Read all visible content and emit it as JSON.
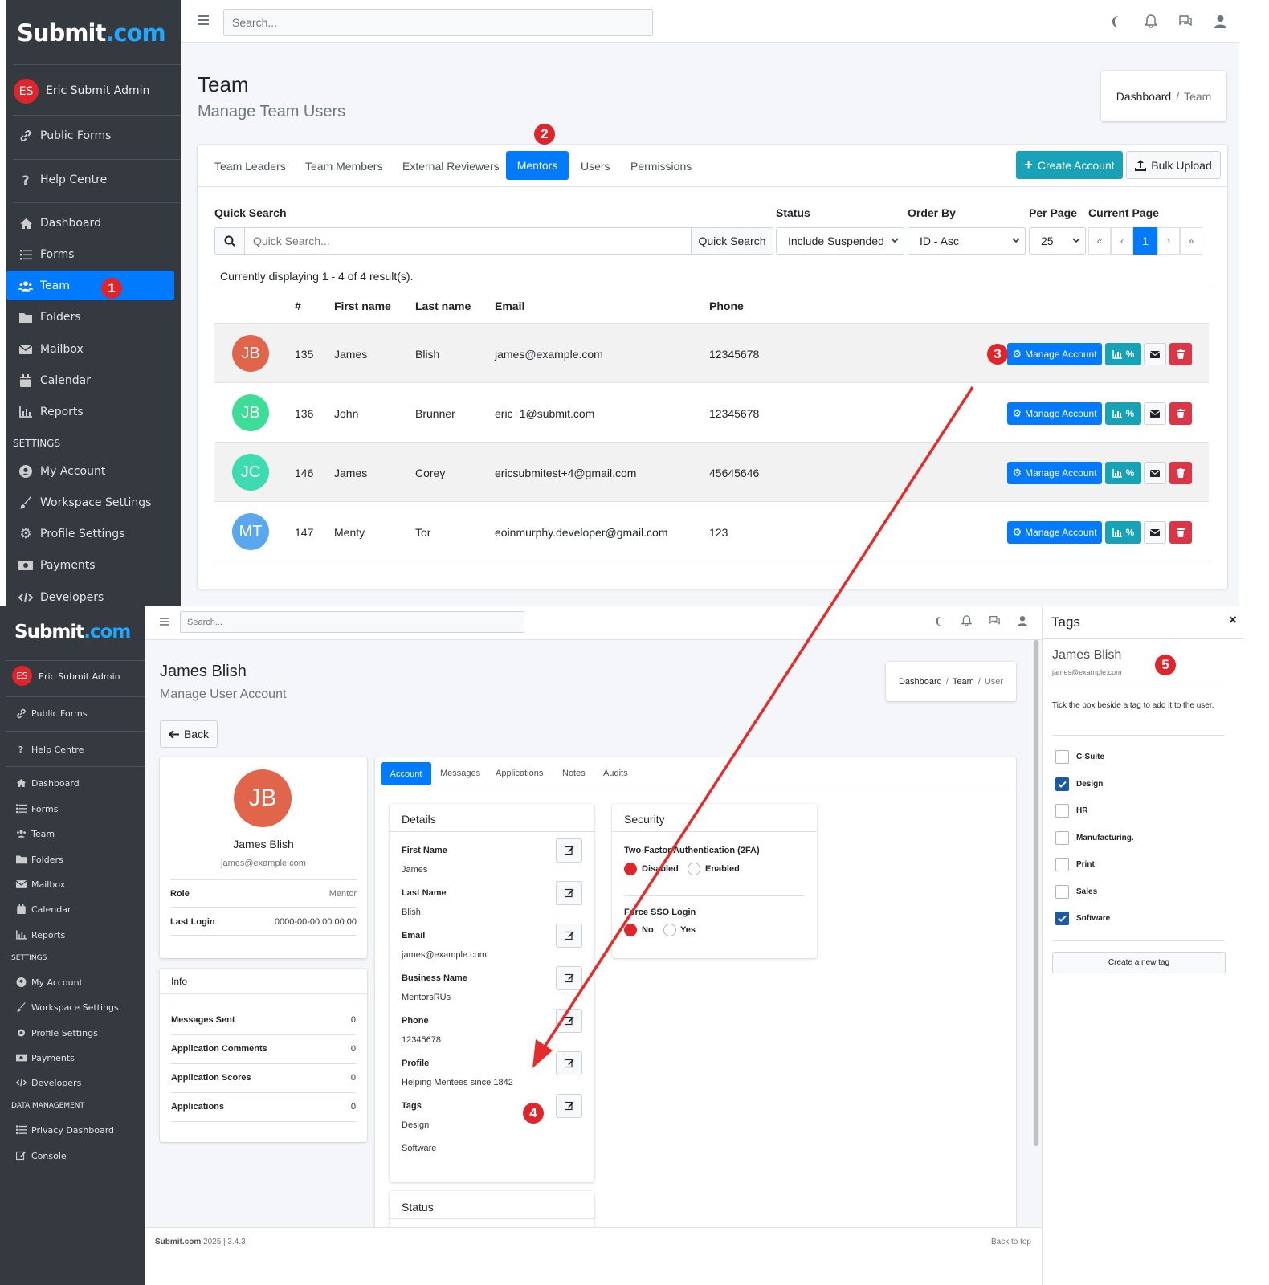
{
  "colors": {
    "brand": "#007bff",
    "sidebar": "#343a40",
    "danger": "#e0242b",
    "info": "#17a2b8",
    "teal": "#17a2b8",
    "marker": "#e0242b"
  },
  "top": {
    "logo": {
      "a": "Submit",
      "b": ".com"
    },
    "user": {
      "initials": "ES",
      "name": "Eric Submit Admin"
    },
    "nav": {
      "public_forms": "Public Forms",
      "help": "Help Centre",
      "dashboard": "Dashboard",
      "forms": "Forms",
      "team": "Team",
      "folders": "Folders",
      "mailbox": "Mailbox",
      "calendar": "Calendar",
      "reports": "Reports",
      "settings": "SETTINGS",
      "my_account": "My Account",
      "workspace": "Workspace Settings",
      "profile": "Profile Settings",
      "payments": "Payments",
      "developers": "Developers"
    },
    "search_placeholder": "Search...",
    "title": "Team",
    "subtitle": "Manage Team Users",
    "breadcrumb": {
      "a": "Dashboard",
      "sep": "/",
      "b": "Team"
    },
    "tabs": [
      "Team Leaders",
      "Team Members",
      "External Reviewers",
      "Mentors",
      "Users",
      "Permissions"
    ],
    "create_account": "Create Account",
    "bulk_upload": "Bulk Upload",
    "filters": {
      "quick_search": "Quick Search",
      "quick_placeholder": "Quick Search...",
      "quick_button": "Quick Search",
      "status": "Status",
      "status_value": "Include Suspended",
      "order_by": "Order By",
      "order_value": "ID - Asc",
      "per_page": "Per Page",
      "per_page_value": "25",
      "current_page": "Current Page",
      "page": "1",
      "first": "«",
      "prev": "‹",
      "next": "›",
      "last": "»"
    },
    "results": "Currently displaying 1 - 4 of 4 result(s).",
    "columns": {
      "num": "#",
      "first": "First name",
      "last": "Last name",
      "email": "Email",
      "phone": "Phone"
    },
    "rows": [
      {
        "initials": "JB",
        "color": "#e0654a",
        "id": "135",
        "first": "James",
        "last": "Blish",
        "email": "james@example.com",
        "phone": "12345678"
      },
      {
        "initials": "JB",
        "color": "#3ddc97",
        "id": "136",
        "first": "John",
        "last": "Brunner",
        "email": "eric+1@submit.com",
        "phone": "12345678"
      },
      {
        "initials": "JC",
        "color": "#3ddcb0",
        "id": "146",
        "first": "James",
        "last": "Corey",
        "email": "ericsubmitest+4@gmail.com",
        "phone": "45645646"
      },
      {
        "initials": "MT",
        "color": "#5aa6ef",
        "id": "147",
        "first": "Menty",
        "last": "Tor",
        "email": "eoinmurphy.developer@gmail.com",
        "phone": "123"
      }
    ],
    "manage_account": "Manage Account",
    "stats_label": "%"
  },
  "markers": [
    "1",
    "2",
    "3",
    "4",
    "5"
  ],
  "bottom": {
    "logo": {
      "a": "Submit",
      "b": ".com"
    },
    "user": {
      "initials": "ES",
      "name": "Eric Submit Admin"
    },
    "nav": {
      "public_forms": "Public Forms",
      "help": "Help Centre",
      "dashboard": "Dashboard",
      "forms": "Forms",
      "team": "Team",
      "folders": "Folders",
      "mailbox": "Mailbox",
      "calendar": "Calendar",
      "reports": "Reports",
      "settings": "SETTINGS",
      "my_account": "My Account",
      "workspace": "Workspace Settings",
      "profile": "Profile Settings",
      "payments": "Payments",
      "developers": "Developers",
      "data_mgmt": "DATA MANAGEMENT",
      "privacy": "Privacy Dashboard",
      "console": "Console"
    },
    "search_placeholder": "Search...",
    "title": "James Blish",
    "subtitle": "Manage User Account",
    "breadcrumb": {
      "a": "Dashboard",
      "b": "Team",
      "c": "User",
      "sep": "/"
    },
    "back": "Back",
    "profile": {
      "initials": "JB",
      "color": "#e0654a",
      "name": "James Blish",
      "email": "james@example.com",
      "role_label": "Role",
      "role": "Mentor",
      "login_label": "Last Login",
      "login": "0000-00-00 00:00:00"
    },
    "info": {
      "title": "Info",
      "rows": [
        {
          "label": "Messages Sent",
          "value": "0"
        },
        {
          "label": "Application Comments",
          "value": "0"
        },
        {
          "label": "Application Scores",
          "value": "0"
        },
        {
          "label": "Applications",
          "value": "0"
        }
      ]
    },
    "tabs": [
      "Account",
      "Messages",
      "Applications",
      "Notes",
      "Audits"
    ],
    "details": {
      "title": "Details",
      "fields": [
        {
          "label": "First Name",
          "value": "James"
        },
        {
          "label": "Last Name",
          "value": "Blish"
        },
        {
          "label": "Email",
          "value": "james@example.com"
        },
        {
          "label": "Business Name",
          "value": "MentorsRUs"
        },
        {
          "label": "Phone",
          "value": "12345678"
        },
        {
          "label": "Profile",
          "value": "Helping Mentees since 1842"
        },
        {
          "label": "Tags",
          "value": "Design",
          "value2": "Software"
        }
      ]
    },
    "status_title": "Status",
    "security": {
      "title": "Security",
      "twofa": "Two-Factor Authentication (2FA)",
      "disabled": "Disabled",
      "enabled": "Enabled",
      "sso": "Force SSO Login",
      "no": "No",
      "yes": "Yes"
    },
    "footer": {
      "brand": "Submit.com",
      "year": "2025 | 3.4.3",
      "back_top": "Back to top"
    }
  },
  "tags_panel": {
    "title": "Tags",
    "close": "×",
    "name": "James Blish",
    "email": "james@example.com",
    "hint": "Tick the box beside a tag to add it to the user.",
    "tags": [
      {
        "name": "C-Suite",
        "checked": false
      },
      {
        "name": "Design",
        "checked": true
      },
      {
        "name": "HR",
        "checked": false
      },
      {
        "name": "Manufacturing.",
        "checked": false
      },
      {
        "name": "Print",
        "checked": false
      },
      {
        "name": "Sales",
        "checked": false
      },
      {
        "name": "Software",
        "checked": true
      }
    ],
    "create": "Create a new tag"
  }
}
